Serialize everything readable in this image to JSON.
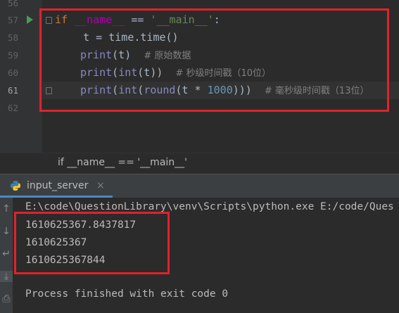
{
  "editor": {
    "line_numbers": [
      "56",
      "57",
      "58",
      "59",
      "60",
      "61",
      "62"
    ],
    "line57": {
      "kw": "if",
      "dunder": "__name__",
      "op": " == ",
      "str": "'__main__'",
      "colon": ":"
    },
    "line58": {
      "text": "    t = time.time()"
    },
    "line59": {
      "fn": "print",
      "args": "(t)",
      "comment": "# 原始数据"
    },
    "line60": {
      "fn": "print",
      "open": "(",
      "fn2": "int",
      "args": "(t))",
      "comment": "# 秒级时间戳（10位）"
    },
    "line61": {
      "fn": "print",
      "open": "(",
      "fn2": "int",
      "open2": "(",
      "fn3": "round",
      "mid": "(t * ",
      "num": "1000",
      "close": ")))",
      "comment": "# 毫秒级时间戳（13位）"
    }
  },
  "breadcrumb": {
    "text": "if __name__ == '__main__'"
  },
  "run_panel": {
    "tab_label": "input_server",
    "tab_close": "×",
    "icons": {
      "up": "↑",
      "down": "↓",
      "wrap": "↵",
      "download": "⤓",
      "print": "⎙"
    },
    "console_lines": [
      "E:\\code\\QuestionLibrary\\venv\\Scripts\\python.exe E:/code/Ques",
      "1610625367.8437817",
      "1610625367",
      "1610625367844",
      "",
      "Process finished with exit code 0"
    ]
  },
  "colors": {
    "annotation_red": "#e0222b",
    "keyword": "#cc7832",
    "string": "#6a8759",
    "builtin": "#8888c6",
    "number": "#6897bb",
    "comment": "#808080"
  }
}
